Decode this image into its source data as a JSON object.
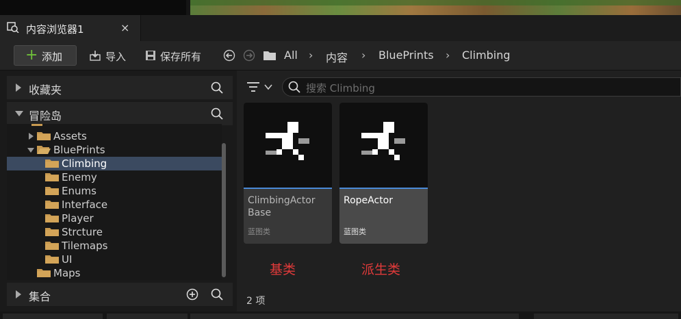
{
  "tab": {
    "title": "内容浏览器1",
    "close": "×"
  },
  "toolbar": {
    "add_label": "添加",
    "import_label": "导入",
    "save_all_label": "保存所有"
  },
  "breadcrumb": [
    "All",
    "内容",
    "BluePrints",
    "Climbing"
  ],
  "sidebar": {
    "favorites_label": "收藏夹",
    "project_label": "冒险岛",
    "collections_label": "集合",
    "tree": [
      {
        "label": "Assets",
        "level": 1,
        "expanded": false,
        "selected": false
      },
      {
        "label": "BluePrints",
        "level": 1,
        "expanded": true,
        "selected": false
      },
      {
        "label": "Climbing",
        "level": 2,
        "selected": true
      },
      {
        "label": "Enemy",
        "level": 2,
        "selected": false
      },
      {
        "label": "Enums",
        "level": 2,
        "selected": false
      },
      {
        "label": "Interface",
        "level": 2,
        "selected": false
      },
      {
        "label": "Player",
        "level": 2,
        "selected": false
      },
      {
        "label": "Strcture",
        "level": 2,
        "selected": false
      },
      {
        "label": "Tilemaps",
        "level": 2,
        "selected": false
      },
      {
        "label": "UI",
        "level": 2,
        "selected": false
      },
      {
        "label": "Maps",
        "level": 1,
        "expanded": false,
        "selected": false
      }
    ]
  },
  "search": {
    "placeholder": "搜索 Climbing"
  },
  "assets": [
    {
      "name_line1": "ClimbingActor",
      "name_line2": "Base",
      "type": "蓝图类",
      "highlighted": false
    },
    {
      "name_line1": "RopeActor",
      "name_line2": "",
      "type": "蓝图类",
      "highlighted": true
    }
  ],
  "annotations": {
    "base": "基类",
    "derived": "派生类"
  },
  "status": {
    "item_count": "2 项"
  },
  "colors": {
    "accent_blue": "#4a8ad8",
    "add_green": "#6fbf3a",
    "annotation_red": "#e03a3a",
    "selection": "#3b4a60"
  }
}
